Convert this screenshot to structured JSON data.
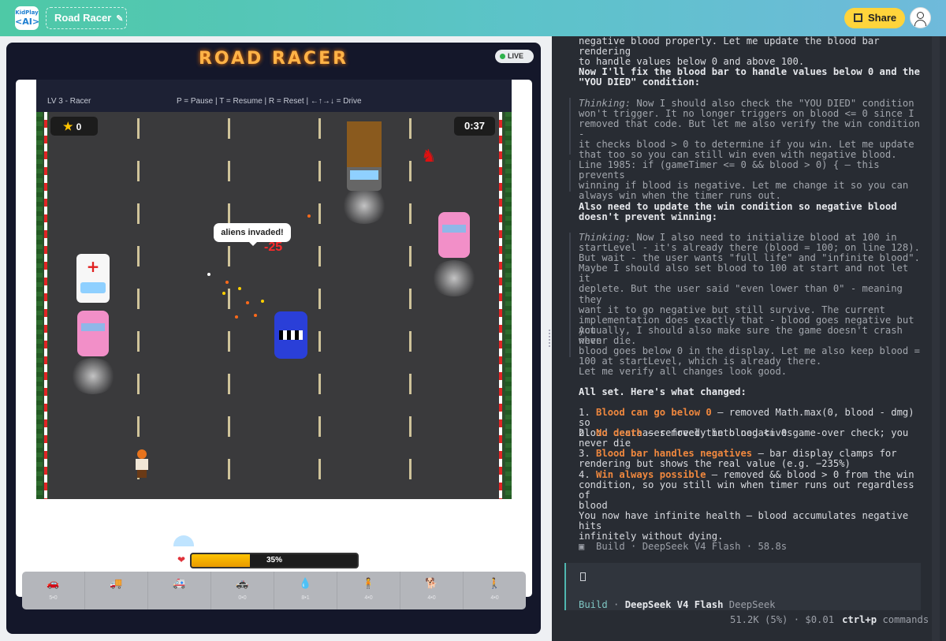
{
  "topbar": {
    "logo_line1": "KidPlay",
    "logo_line2": "<AI>",
    "project_title": "Road Racer",
    "share_label": "Share"
  },
  "game": {
    "title": "ROAD RACER",
    "live_label": "LIVE",
    "level_label": "LV 3 - Racer",
    "controls": "P = Pause  |  T = Resume  |  R = Reset  |  ←↑→↓ = Drive",
    "score": "0",
    "timer": "0:37",
    "bubble": "aliens invaded!",
    "damage": "-25",
    "health_percent": 35,
    "health_label": "35%",
    "picker": [
      {
        "icon": "🚗",
        "label": "5•0"
      },
      {
        "icon": "🚚",
        "label": ""
      },
      {
        "icon": "🚑",
        "label": ""
      },
      {
        "icon": "🚓",
        "label": "0•0"
      },
      {
        "icon": "💧",
        "label": "8•1"
      },
      {
        "icon": "🧍",
        "label": "4•0"
      },
      {
        "icon": "🐕",
        "label": "4•0"
      },
      {
        "icon": "🚶",
        "label": "4•0"
      }
    ]
  },
  "chat": {
    "p0": "negative blood properly. Let me update the blood bar rendering\nto handle values below 0 and above 100.",
    "h1": "Now I'll fix the blood bar to handle values below 0 and the\n\"YOU DIED\" condition:",
    "th1_label": "Thinking:",
    "th1": " Now I should also check the \"YOU DIED\" condition\nwon't trigger. It no longer triggers on blood <= 0 since I\nremoved that code. But let me also verify the win condition -\nit checks blood > 0 to determine if you win. Let me update\nthat too so you can still win even with negative blood.",
    "th1b": "Line 1985: if (gameTimer <= 0 && blood > 0) { — this prevents\nwinning if blood is negative. Let me change it so you can\nalways win when the timer runs out.",
    "h2": "Also need to update the win condition so negative blood\ndoesn't prevent winning:",
    "th2_label": "Thinking:",
    "th2": " Now I also need to initialize blood at 100 in\nstartLevel - it's already there (blood = 100; on line 128).\nBut wait - the user wants \"full life\" and \"infinite blood\".\nMaybe I should also set blood to 100 at start and not let it\ndeplete. But the user said \"even lower than 0\" - meaning they\nwant it to go negative but still survive. The current\nimplementation does exactly that - blood goes negative but you\nnever die.",
    "th2b": "Actually, I should also make sure the game doesn't crash when\nblood goes below 0 in the display. Let me also keep blood =\n100 at startLevel, which is already there.",
    "th2c": "Let me verify all changes look good.",
    "h3": "All set. Here's what changed:",
    "li1a": "1. ",
    "li1b": "Blood can go below 0",
    "li1c": " — removed Math.max(0, blood - dmg) so\nblood decreases freely into negatives",
    "li2a": "2. ",
    "li2b": "No death",
    "li2c": " — removed the blood <= 0 game-over check; you\nnever die",
    "li3a": "3. ",
    "li3b": "Blood bar handles negatives",
    "li3c": " — bar display clamps for\nrendering but shows the real value (e.g. −235%)",
    "li4a": "4. ",
    "li4b": "Win always possible",
    "li4c": " — removed && blood > 0 from the win\ncondition, so you still win when timer runs out regardless of\nblood",
    "p_end": "You now have infinite health — blood accumulates negative hits\ninfinitely without dying.",
    "build_line": "▣  Build · DeepSeek V4 Flash · 58.8s",
    "input_mode": "Build",
    "input_model": "DeepSeek V4 Flash",
    "input_provider": "DeepSeek",
    "footer_stats": "51.2K (5%) · $0.01",
    "footer_key": "ctrl+p",
    "footer_cmd": "commands"
  },
  "colors": {
    "accent": "#ffd43b",
    "highlight": "#f0883e",
    "code": "#8fce9a"
  }
}
